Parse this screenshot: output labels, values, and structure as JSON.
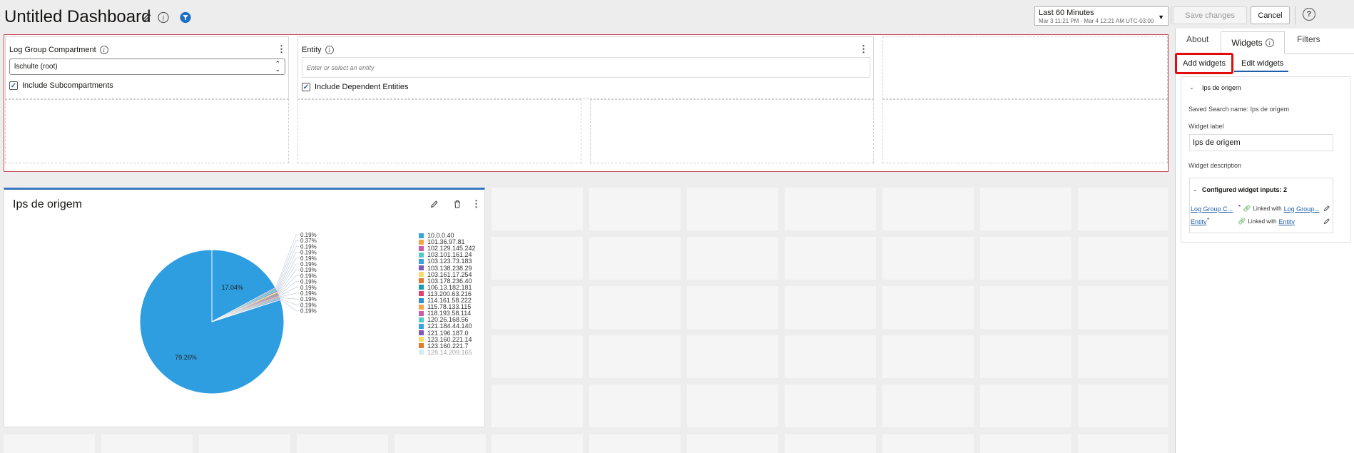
{
  "header": {
    "title": "Untitled Dashboard",
    "time_range": {
      "label": "Last 60 Minutes",
      "sublabel": "Mar 3 11:21 PM - Mar 4 12:21 AM UTC-03:00"
    },
    "save_label": "Save changes",
    "cancel_label": "Cancel",
    "help_glyph": "?"
  },
  "filters": {
    "compartment": {
      "label": "Log Group Compartment",
      "value": "lschulte (root)",
      "checkbox_label": "Include Subcompartments",
      "checked": true
    },
    "entity": {
      "label": "Entity",
      "placeholder": "Enter or select an entity",
      "checkbox_label": "Include Dependent Entities",
      "checked": true
    }
  },
  "widget": {
    "title": "Ips de origem",
    "chart_data": {
      "type": "pie",
      "title": "",
      "slice_labels": [
        "79.26%",
        "17.04%",
        "0.19%",
        "0.37%",
        "0.19%",
        "0.19%",
        "0.19%",
        "0.19%",
        "0.19%",
        "0.19%",
        "0.19%",
        "0.19%",
        "0.19%",
        "0.19%",
        "0.19%",
        "0.19%"
      ],
      "values": [
        79.26,
        17.04,
        0.19,
        0.37,
        0.19,
        0.19,
        0.19,
        0.19,
        0.19,
        0.19,
        0.19,
        0.19,
        0.19,
        0.19,
        0.19,
        0.19
      ],
      "legend": [
        {
          "label": "10.0.0.40",
          "color": "#3aa3dd"
        },
        {
          "label": "101.36.97.81",
          "color": "#f4a54a"
        },
        {
          "label": "102.129.145.242",
          "color": "#c95fa8"
        },
        {
          "label": "103.101.161.24",
          "color": "#56c9c9"
        },
        {
          "label": "103.123.73.183",
          "color": "#3aa3dd"
        },
        {
          "label": "103.138.238.29",
          "color": "#7d5bb8"
        },
        {
          "label": "103.161.17.254",
          "color": "#f6dc6a"
        },
        {
          "label": "103.178.236.40",
          "color": "#e07a2e"
        },
        {
          "label": "106.13.182.181",
          "color": "#1a9bb0"
        },
        {
          "label": "113.200.63.216",
          "color": "#e0416e"
        },
        {
          "label": "114.161.58.222",
          "color": "#2f8fd0"
        },
        {
          "label": "115.78.133.115",
          "color": "#f4a54a"
        },
        {
          "label": "118.193.58.114",
          "color": "#c95fa8"
        },
        {
          "label": "120.26.168.56",
          "color": "#56c9c9"
        },
        {
          "label": "121.184.44.140",
          "color": "#3aa3dd"
        },
        {
          "label": "121.196.187.0",
          "color": "#7d5bb8"
        },
        {
          "label": "123.160.221.14",
          "color": "#f6dc6a"
        },
        {
          "label": "123.160.221.7",
          "color": "#e07a2e"
        },
        {
          "label": "128.14.209.165",
          "color": "#9fd8e8"
        }
      ]
    }
  },
  "side_panel": {
    "tabs": {
      "about": "About",
      "widgets": "Widgets",
      "filters": "Filters"
    },
    "subtabs": {
      "add": "Add widgets",
      "edit": "Edit widgets"
    },
    "section_title": "Ips de origem",
    "saved_search": "Saved Search name: Ips de origem",
    "widget_label_caption": "Widget label",
    "widget_label_value": "Ips de origem",
    "widget_description_caption": "Widget description",
    "configured_inputs": "Configured widget inputs: 2",
    "inputs": [
      {
        "name": "Log Group C...",
        "marker": "*",
        "linked_text": "Linked with",
        "linked_to": "Log Group..."
      },
      {
        "name": "Entity",
        "marker": "*",
        "linked_text": "Linked with",
        "linked_to": "Entity"
      }
    ]
  }
}
